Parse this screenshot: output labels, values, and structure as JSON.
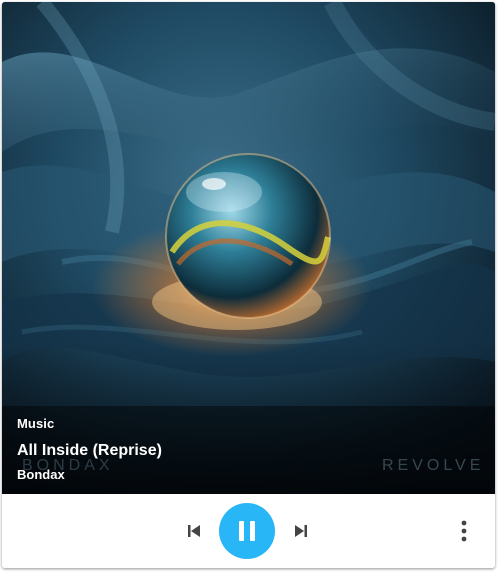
{
  "player": {
    "source": "Music",
    "title": "All Inside (Reprise)",
    "artist": "Bondax",
    "artwork_text_left": "BONDAX",
    "artwork_text_right": "REVOLVE",
    "state": "playing"
  },
  "controls": {
    "previous_icon": "skip-previous-icon",
    "play_pause_icon": "pause-icon",
    "next_icon": "skip-next-icon",
    "more_icon": "more-vertical-icon"
  },
  "colors": {
    "accent": "#29b6f6",
    "control_icon": "#444444",
    "overlay_text": "#ffffff"
  }
}
